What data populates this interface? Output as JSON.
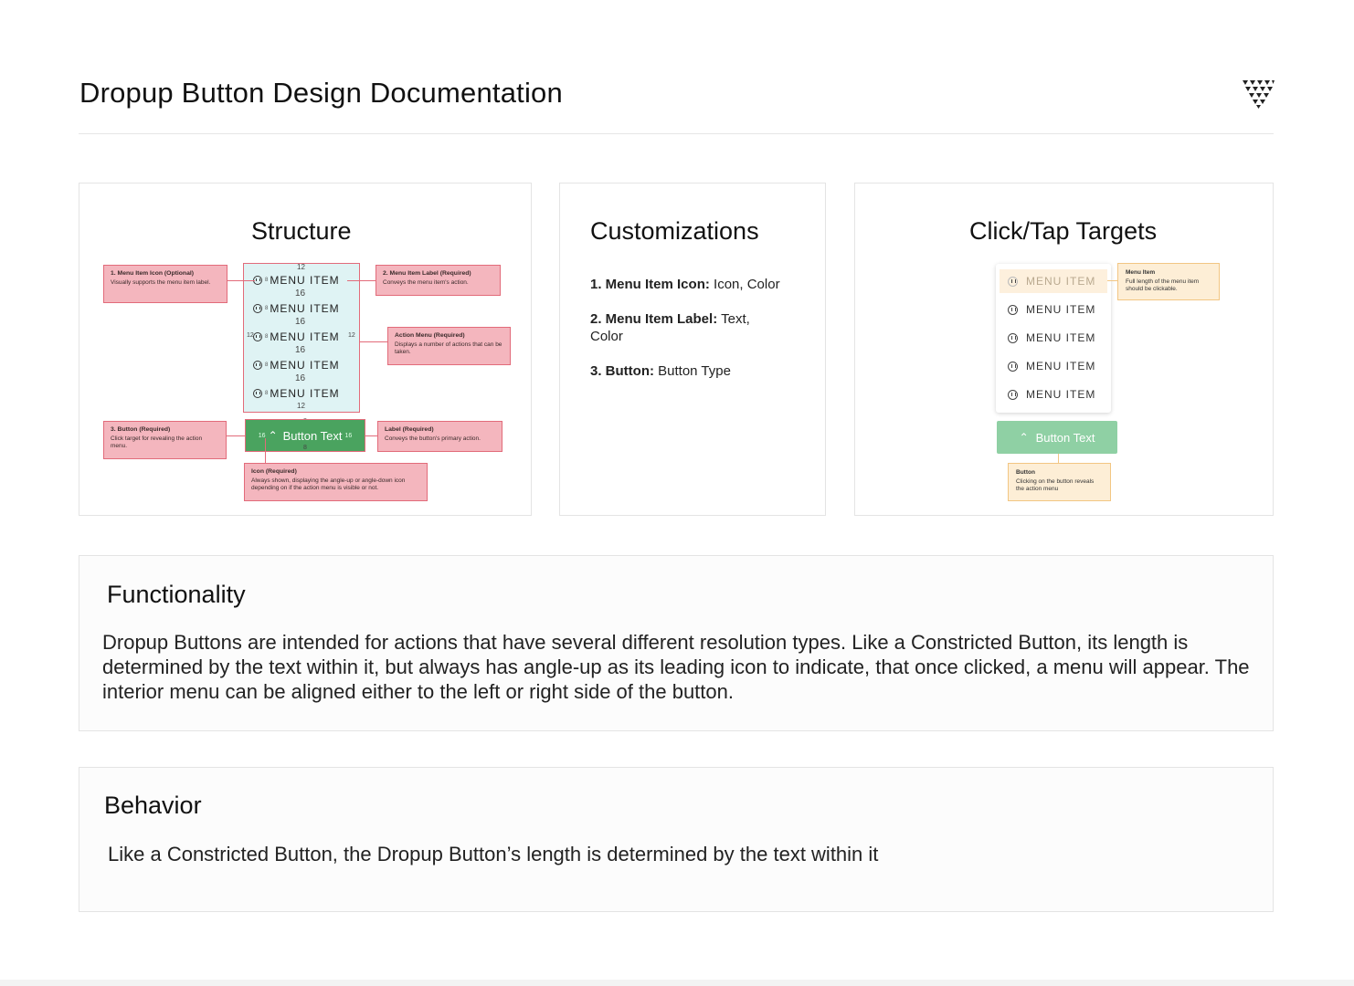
{
  "page": {
    "title": "Dropup Button Design Documentation"
  },
  "structure": {
    "title": "Structure",
    "menu_item_label": "MENU ITEM",
    "button_text": "Button Text",
    "spacing": {
      "top": "12",
      "gap": "16",
      "side": "12",
      "icon_gap": "8",
      "button_side": "16",
      "button_v": "8"
    },
    "annotations": {
      "icon": {
        "title": "1. Menu Item Icon (Optional)",
        "body": "Visually supports the menu item label."
      },
      "label": {
        "title": "2. Menu Item Label (Required)",
        "body": "Conveys the menu item's action."
      },
      "action_menu": {
        "title": "Action Menu (Required)",
        "body": "Displays a number of actions that can be taken."
      },
      "button": {
        "title": "3. Button (Required)",
        "body": "Click target for revealing the action menu."
      },
      "button_label": {
        "title": "Label (Required)",
        "body": "Conveys the button's primary action."
      },
      "button_icon": {
        "title": "Icon (Required)",
        "body": "Always shown, displaying the angle-up or angle-down icon depending on if the action menu is visible or not."
      }
    }
  },
  "customizations": {
    "title": "Customizations",
    "items": [
      {
        "key": "1. Menu Item Icon:",
        "value": "Icon, Color"
      },
      {
        "key": "2. Menu Item Label:",
        "value": "Text, Color"
      },
      {
        "key": "3. Button:",
        "value": "Button Type"
      }
    ]
  },
  "targets": {
    "title": "Click/Tap Targets",
    "menu_item_label": "MENU ITEM",
    "button_text": "Button Text",
    "tips": {
      "menu_item": {
        "title": "Menu Item",
        "body": "Full length of the menu item should be clickable."
      },
      "button": {
        "title": "Button",
        "body": "Clicking on the button reveals the action menu"
      }
    }
  },
  "functionality": {
    "title": "Functionality",
    "body": "Dropup Buttons are intended for actions that have several different resolution types. Like a Constricted Button, its length is determined by the text within it, but always has angle-up as its leading icon to indicate, that once clicked, a menu will appear. The interior menu can be aligned either to the left or right side of the button."
  },
  "behavior": {
    "title": "Behavior",
    "body": "Like a Constricted Button, the Dropup Button’s length is determined by the text within it"
  }
}
